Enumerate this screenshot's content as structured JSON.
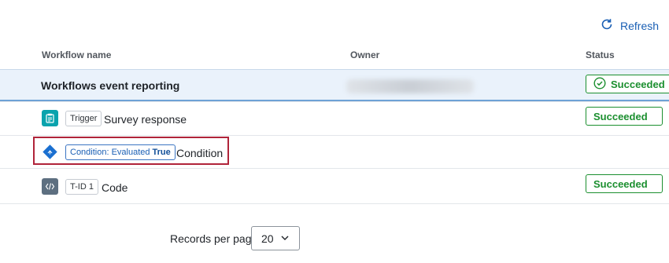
{
  "toolbar": {
    "refresh_label": "Refresh"
  },
  "columns": {
    "workflow_name": "Workflow name",
    "owner": "Owner",
    "status": "Status"
  },
  "selected_row": {
    "name": "Workflows event reporting",
    "status": "Succeeded"
  },
  "rows": [
    {
      "tag": "Trigger",
      "label": "Survey response",
      "status": "Succeeded",
      "icon": "clipboard-icon"
    },
    {
      "tag_prefix": "Condition: Evaluated",
      "tag_value": "True",
      "label": "Condition",
      "status": "",
      "icon": "branch-diamond-icon"
    },
    {
      "tag": "T-ID 1",
      "label": "Code",
      "status": "Succeeded",
      "icon": "code-icon"
    }
  ],
  "pagination": {
    "records_label": "Records per page",
    "per_page_value": "20"
  },
  "colors": {
    "accent": "#1a5fb4",
    "success": "#1b8f2f",
    "highlight_border": "#b0243a",
    "selected_bg": "#eaf2fb"
  }
}
